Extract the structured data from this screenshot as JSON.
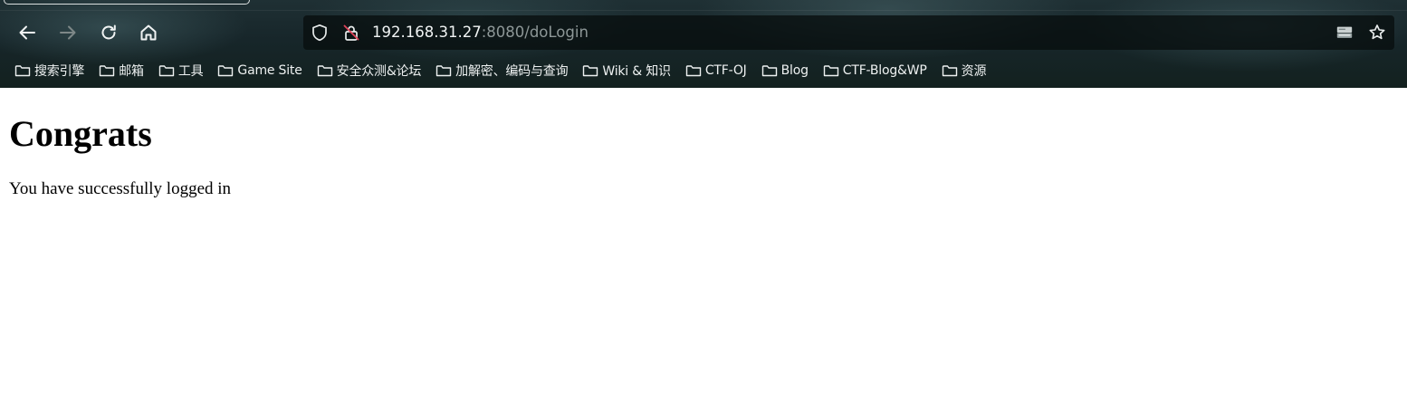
{
  "browser": {
    "toolbar": {
      "back_icon": "arrow-left-icon",
      "forward_icon": "arrow-right-icon",
      "reload_icon": "reload-icon",
      "home_icon": "home-icon"
    },
    "urlbar": {
      "host": "192.168.31.27",
      "rest": ":8080/doLogin",
      "shield_icon": "shield-icon",
      "insecure_icon": "insecure-lock-icon",
      "right_icons": [
        "screenshot-drive-icon",
        "star-icon"
      ]
    },
    "bookmarks": [
      {
        "label": "搜索引擎"
      },
      {
        "label": "邮箱"
      },
      {
        "label": "工具"
      },
      {
        "label": "Game Site"
      },
      {
        "label": "安全众测&论坛"
      },
      {
        "label": "加解密、编码与查询"
      },
      {
        "label": "Wiki & 知识"
      },
      {
        "label": "CTF-OJ"
      },
      {
        "label": "Blog"
      },
      {
        "label": "CTF-Blog&WP"
      },
      {
        "label": "资源"
      }
    ],
    "colors": {
      "chrome_bg": "#17262a",
      "url_muted": "#8d9797",
      "insecure_strike": "#e0445a"
    }
  },
  "page": {
    "heading": "Congrats",
    "message": "You have successfully logged in"
  }
}
